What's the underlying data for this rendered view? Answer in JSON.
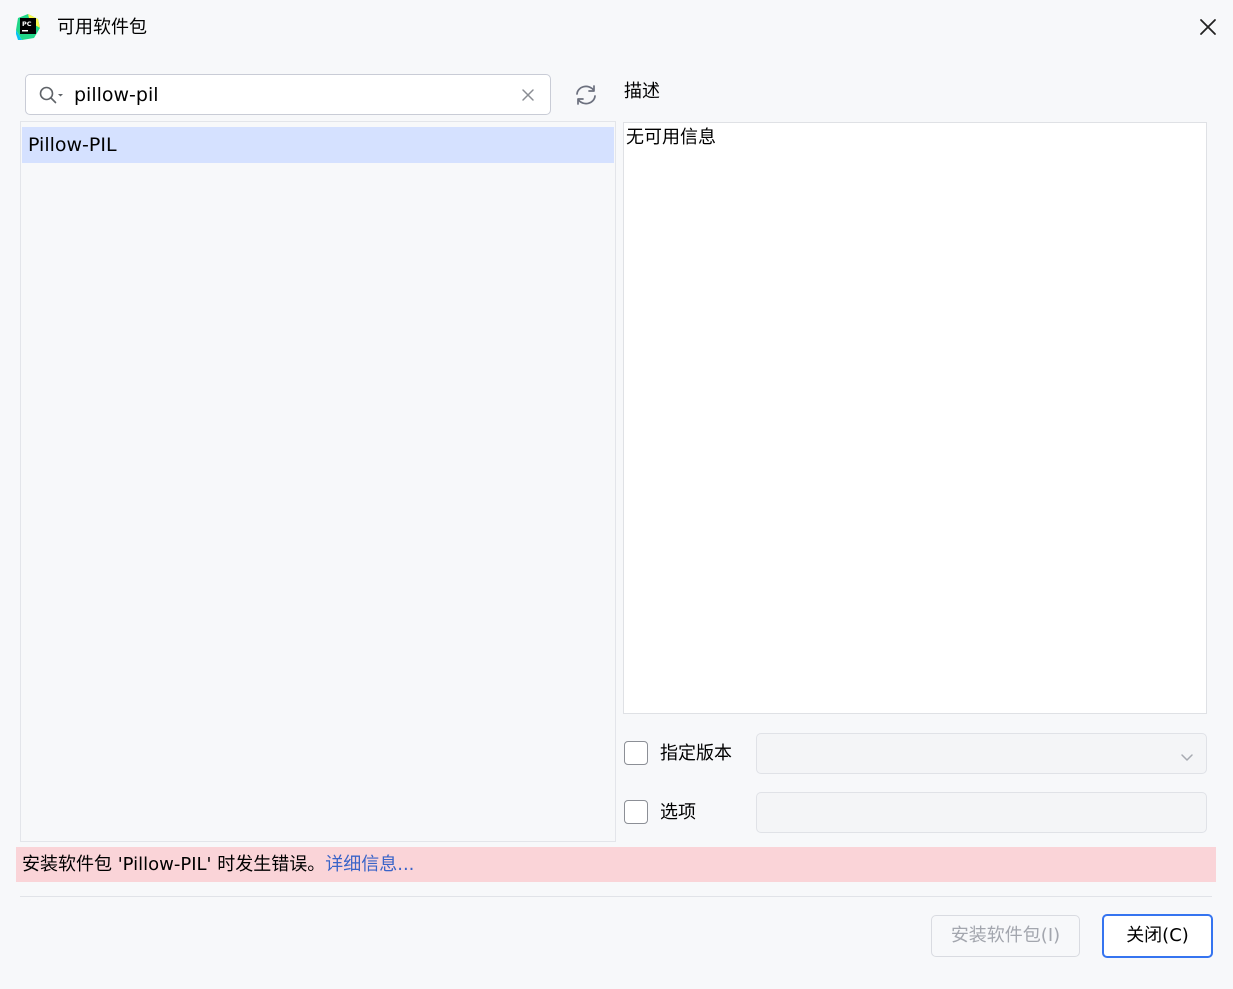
{
  "window": {
    "title": "可用软件包",
    "logo_icon": "pycharm-logo-icon",
    "close_icon": "close-icon"
  },
  "search": {
    "value": "pillow-pil",
    "search_icon": "search-icon",
    "clear_icon": "clear-icon",
    "refresh_icon": "refresh-icon"
  },
  "package_list": {
    "items": [
      {
        "label": "Pillow-PIL",
        "selected": true
      }
    ]
  },
  "description": {
    "label": "描述",
    "text": "无可用信息"
  },
  "version": {
    "label": "指定版本",
    "checked": false,
    "selected_value": "",
    "chevron_icon": "chevron-down-icon"
  },
  "options": {
    "label": "选项",
    "checked": false,
    "value": ""
  },
  "error": {
    "message": "安装软件包 'Pillow-PIL' 时发生错误。",
    "link_label": "详细信息..."
  },
  "buttons": {
    "install_label": "安装软件包(I)",
    "close_label": "关闭(C)"
  },
  "colors": {
    "background": "#f7f8fa",
    "selection": "#d5e1ff",
    "error_background": "#fad4d8",
    "link": "#3a64c8",
    "primary_border": "#3574f0"
  }
}
